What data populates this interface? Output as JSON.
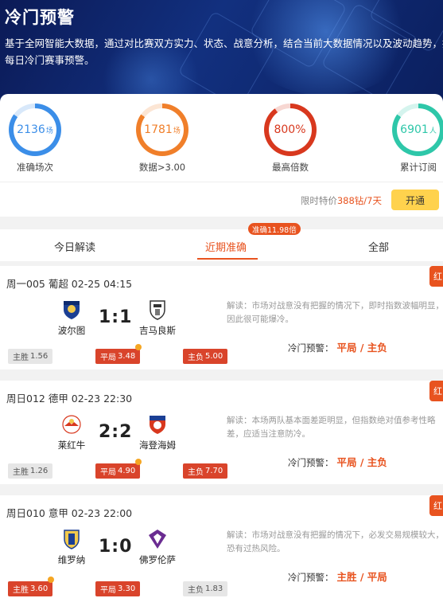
{
  "header": {
    "title": "冷门预警",
    "description_line1": "基于全网智能大数据，通过对比赛双方实力、状态、战意分析，结合当前大数据情况以及波动趋势，提供",
    "description_line2": "每日冷门赛事预警。"
  },
  "stats": [
    {
      "value": "2136",
      "unit": "场",
      "label": "准确场次",
      "color": "#3b8ee8",
      "fill": 0.85
    },
    {
      "value": "1781",
      "unit": "场",
      "label": "数据>3.00",
      "color": "#f07f2a",
      "fill": 0.85
    },
    {
      "value": "800%",
      "unit": "",
      "label": "最高倍数",
      "color": "#d8381e",
      "fill": 0.9
    },
    {
      "value": "6901",
      "unit": "人",
      "label": "累计订阅",
      "color": "#2ec7a9",
      "fill": 0.85
    }
  ],
  "promo": {
    "prefix": "限时特价",
    "price": "388钻/7天",
    "button": "开通"
  },
  "tabs": {
    "items": [
      "今日解读",
      "近期准确",
      "全部"
    ],
    "active_index": 1,
    "badge": "准确11.98倍"
  },
  "matches": [
    {
      "header": "周一005 葡超 02-25 04:15",
      "flag": "红",
      "home": "波尔图",
      "away": "吉马良斯",
      "score": "1:1",
      "tags": [
        {
          "label": "主胜",
          "odds": "1.56",
          "style": "grey"
        },
        {
          "label": "平局",
          "odds": "3.48",
          "style": "red",
          "check": true
        },
        {
          "label": "主负",
          "odds": "5.00",
          "style": "red"
        }
      ],
      "analysis": "解读：市场对战意没有把握的情况下，即时指数波幅明显，因此很可能爆冷。",
      "pred_label": "冷门预警：",
      "pred_value": "平局 / 主负"
    },
    {
      "header": "周日012 德甲 02-23 22:30",
      "flag": "红",
      "home": "莱红牛",
      "away": "海登海姆",
      "score": "2:2",
      "tags": [
        {
          "label": "主胜",
          "odds": "1.26",
          "style": "grey"
        },
        {
          "label": "平局",
          "odds": "4.90",
          "style": "red",
          "check": true
        },
        {
          "label": "主负",
          "odds": "7.70",
          "style": "red"
        }
      ],
      "analysis": "解读：本场两队基本面差距明显，但指数绝对值参考性略差，应适当注意防冷。",
      "pred_label": "冷门预警：",
      "pred_value": "平局 / 主负"
    },
    {
      "header": "周日010 意甲 02-23 22:00",
      "flag": "红",
      "home": "维罗纳",
      "away": "佛罗伦萨",
      "score": "1:0",
      "tags": [
        {
          "label": "主胜",
          "odds": "3.60",
          "style": "red",
          "check": true
        },
        {
          "label": "平局",
          "odds": "3.30",
          "style": "red"
        },
        {
          "label": "主负",
          "odds": "1.83",
          "style": "grey"
        }
      ],
      "analysis": "解读：市场对战意没有把握的情况下，必发交易规模较大，恐有过热风险。",
      "pred_label": "冷门预警：",
      "pred_value": "主胜 / 平局"
    }
  ]
}
